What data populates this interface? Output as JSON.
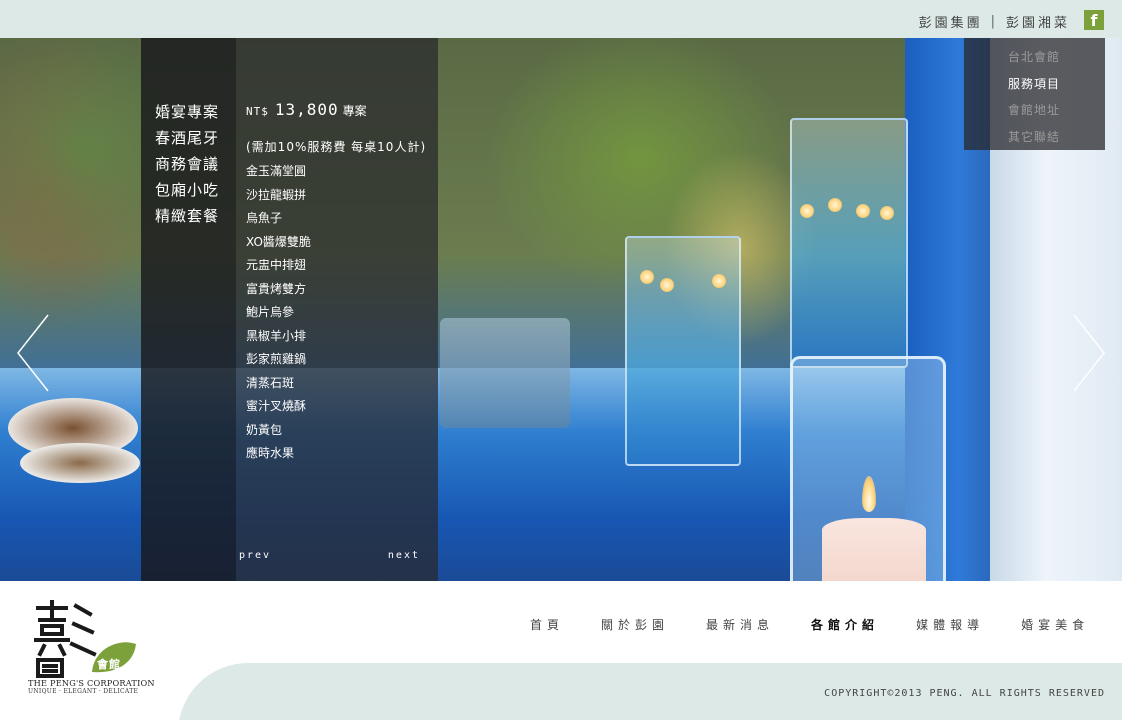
{
  "topbar": {
    "link_group": "彭園集團",
    "separator": "|",
    "link_restaurant": "彭園湘菜",
    "facebook_label": "f"
  },
  "leftnav": {
    "items": [
      "婚宴專案",
      "春酒尾牙",
      "商務會議",
      "包廂小吃",
      "精緻套餐"
    ]
  },
  "menu": {
    "currency": "NT$",
    "price": "13,800",
    "package_label": "專案",
    "note": "(需加10%服務費 每桌10人計)",
    "dishes": [
      "金玉滿堂圓",
      "沙拉龍蝦拼",
      "烏魚子",
      "XO醬爆雙脆",
      "元盅中排翅",
      "富貴烤雙方",
      "鮑片烏參",
      "黑椒羊小排",
      "彭家煎雞鍋",
      "清蒸石斑",
      "蜜汁叉燒酥",
      "奶黃包",
      "應時水果"
    ],
    "prev_label": "prev",
    "next_label": "next"
  },
  "rightnav": {
    "items": [
      "台北會館",
      "服務項目",
      "會館地址",
      "其它聯結"
    ],
    "active_index": 1
  },
  "slider": {
    "dot_count": 5,
    "active_dot": 0
  },
  "mainnav": {
    "items": [
      "首頁",
      "關於彭園",
      "最新消息",
      "各館介紹",
      "媒體報導",
      "婚宴美食"
    ],
    "current_index": 3
  },
  "logo": {
    "hall_label": "會館",
    "corporation": "THE PENG'S CORPORATION",
    "tagline": "UNIQUE · ELEGANT · DELICATE"
  },
  "footer": {
    "copyright": "COPYRIGHT©2013 PENG. ALL RIGHTS RESERVED"
  },
  "colors": {
    "topbar_bg": "#dde9e6",
    "facebook_green": "#7da13a",
    "dot_active": "#c6c843",
    "dot_inactive": "#7aa15a"
  }
}
